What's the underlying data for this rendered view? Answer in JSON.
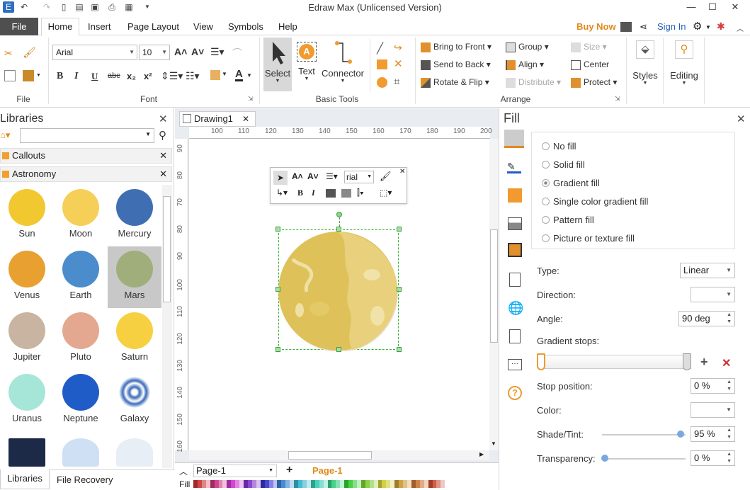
{
  "app": {
    "title": "Edraw Max (Unlicensed Version)"
  },
  "menu": {
    "file": "File",
    "items": [
      "Home",
      "Insert",
      "Page Layout",
      "View",
      "Symbols",
      "Help"
    ],
    "buy_now": "Buy Now",
    "sign_in": "Sign In"
  },
  "ribbon": {
    "file_group": "File",
    "font_group": "Font",
    "font_name": "Arial",
    "font_size": "10",
    "basic_tools_group": "Basic Tools",
    "select_label": "Select",
    "text_label": "Text",
    "connector_label": "Connector",
    "arrange_group": "Arrange",
    "bring_to_front": "Bring to Front",
    "send_to_back": "Send to Back",
    "rotate_flip": "Rotate & Flip",
    "group": "Group",
    "align": "Align",
    "distribute": "Distribute",
    "size": "Size",
    "center": "Center",
    "protect": "Protect",
    "styles": "Styles",
    "editing": "Editing"
  },
  "libraries": {
    "title": "Libraries",
    "callouts": "Callouts",
    "astronomy": "Astronomy",
    "shapes": [
      {
        "name": "Sun",
        "color": "#f2c830"
      },
      {
        "name": "Moon",
        "color": "#f6cf58"
      },
      {
        "name": "Mercury",
        "color": "#3f6fb2"
      },
      {
        "name": "Venus",
        "color": "#e8a030"
      },
      {
        "name": "Earth",
        "color": "#4a8ccc"
      },
      {
        "name": "Mars",
        "color": "#9fae7a"
      },
      {
        "name": "Jupiter",
        "color": "#c8b4a0"
      },
      {
        "name": "Pluto",
        "color": "#e4a890"
      },
      {
        "name": "Saturn",
        "color": "#f6d040"
      },
      {
        "name": "Uranus",
        "color": "#a6e6d8"
      },
      {
        "name": "Neptune",
        "color": "#1f5cc8"
      },
      {
        "name": "Galaxy",
        "color": "#3a6ab8"
      }
    ],
    "bottom_tabs": [
      "Libraries",
      "File Recovery"
    ]
  },
  "canvas": {
    "doc_tab": "Drawing1",
    "ruler_h": [
      "100",
      "110",
      "120",
      "130",
      "140",
      "150",
      "160",
      "170",
      "180",
      "190",
      "200"
    ],
    "ruler_v": [
      "90",
      "80",
      "70",
      "80",
      "90",
      "100",
      "110",
      "120",
      "130",
      "140",
      "150",
      "160"
    ],
    "mini_font": "rial",
    "page_select": "Page-1",
    "page_tab": "Page-1",
    "fill_label": "Fill"
  },
  "fill": {
    "title": "Fill",
    "options": [
      "No fill",
      "Solid fill",
      "Gradient fill",
      "Single color gradient fill",
      "Pattern fill",
      "Picture or texture fill"
    ],
    "selected": "Gradient fill",
    "type_label": "Type:",
    "type_value": "Linear",
    "direction_label": "Direction:",
    "angle_label": "Angle:",
    "angle_value": "90 deg",
    "stops_label": "Gradient stops:",
    "stop_position_label": "Stop position:",
    "stop_position_value": "0 %",
    "color_label": "Color:",
    "shade_label": "Shade/Tint:",
    "shade_value": "95 %",
    "transparency_label": "Transparency:",
    "transparency_value": "0 %"
  }
}
